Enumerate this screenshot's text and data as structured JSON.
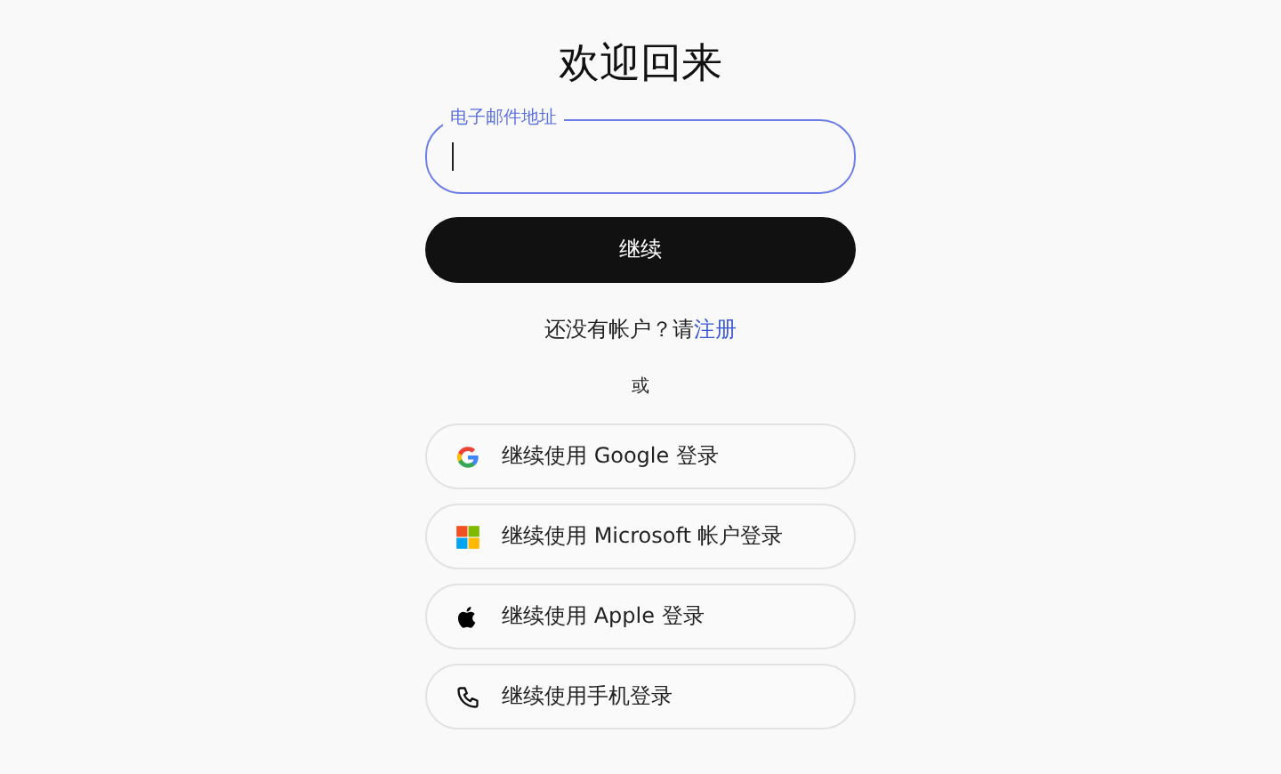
{
  "title": "欢迎回来",
  "email_field": {
    "label": "电子邮件地址",
    "focused": true
  },
  "continue_button": {
    "label": "继续"
  },
  "signup": {
    "prompt": "还没有帐户？请",
    "link": "注册"
  },
  "divider_text": "或",
  "social_buttons": [
    {
      "kind": "google",
      "label": "继续使用 Google 登录"
    },
    {
      "kind": "microsoft",
      "label": "继续使用 Microsoft 帐户登录"
    },
    {
      "kind": "apple",
      "label": "继续使用 Apple 登录"
    },
    {
      "kind": "phone",
      "label": "继续使用手机登录"
    }
  ]
}
